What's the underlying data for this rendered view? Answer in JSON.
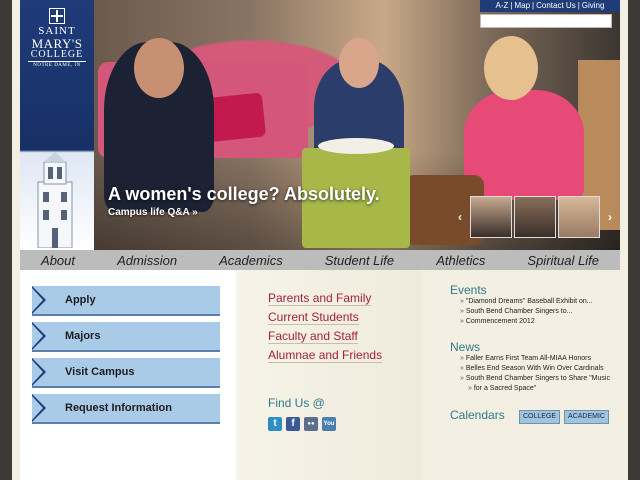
{
  "logo": {
    "line1": "SAINT",
    "line2": "MARY'S",
    "line3": "COLLEGE",
    "line4": "NOTRE DAME, IN"
  },
  "utility": {
    "links": [
      "A-Z",
      "Map",
      "Contact Us",
      "Giving"
    ]
  },
  "hero": {
    "headline": "A women's college? Absolutely.",
    "link": "Campus life Q&A »"
  },
  "nav": {
    "items": [
      "About",
      "Admission",
      "Academics",
      "Student Life",
      "Athletics",
      "Spiritual Life"
    ]
  },
  "quick_links": [
    "Apply",
    "Majors",
    "Visit Campus",
    "Request Information"
  ],
  "audience_links": [
    "Parents and Family",
    "Current Students",
    "Faculty and Staff",
    "Alumnae and Friends"
  ],
  "find_us": {
    "title": "Find Us @",
    "icons": [
      {
        "name": "twitter-icon",
        "glyph": "t",
        "color": "#2e8fc6"
      },
      {
        "name": "facebook-icon",
        "glyph": "f",
        "color": "#3b5998"
      },
      {
        "name": "flickr-icon",
        "glyph": "●●",
        "color": "#5a6f8e"
      },
      {
        "name": "youtube-icon",
        "glyph": "You",
        "color": "#4a7fb1"
      }
    ]
  },
  "events": {
    "title": "Events",
    "items": [
      "\"Diamond Dreams\" Baseball Exhibit on...",
      "South Bend Chamber Singers to...",
      "Commencement 2012"
    ]
  },
  "news": {
    "title": "News",
    "items": [
      "Faller Earns First Team All-MIAA Honors",
      "Belles End Season With Win Over Cardinals",
      "South Bend Chamber Singers to Share \"Music",
      "for a Sacred Space\""
    ]
  },
  "calendars": {
    "title": "Calendars",
    "buttons": [
      "COLLEGE",
      "ACADEMIC"
    ]
  }
}
